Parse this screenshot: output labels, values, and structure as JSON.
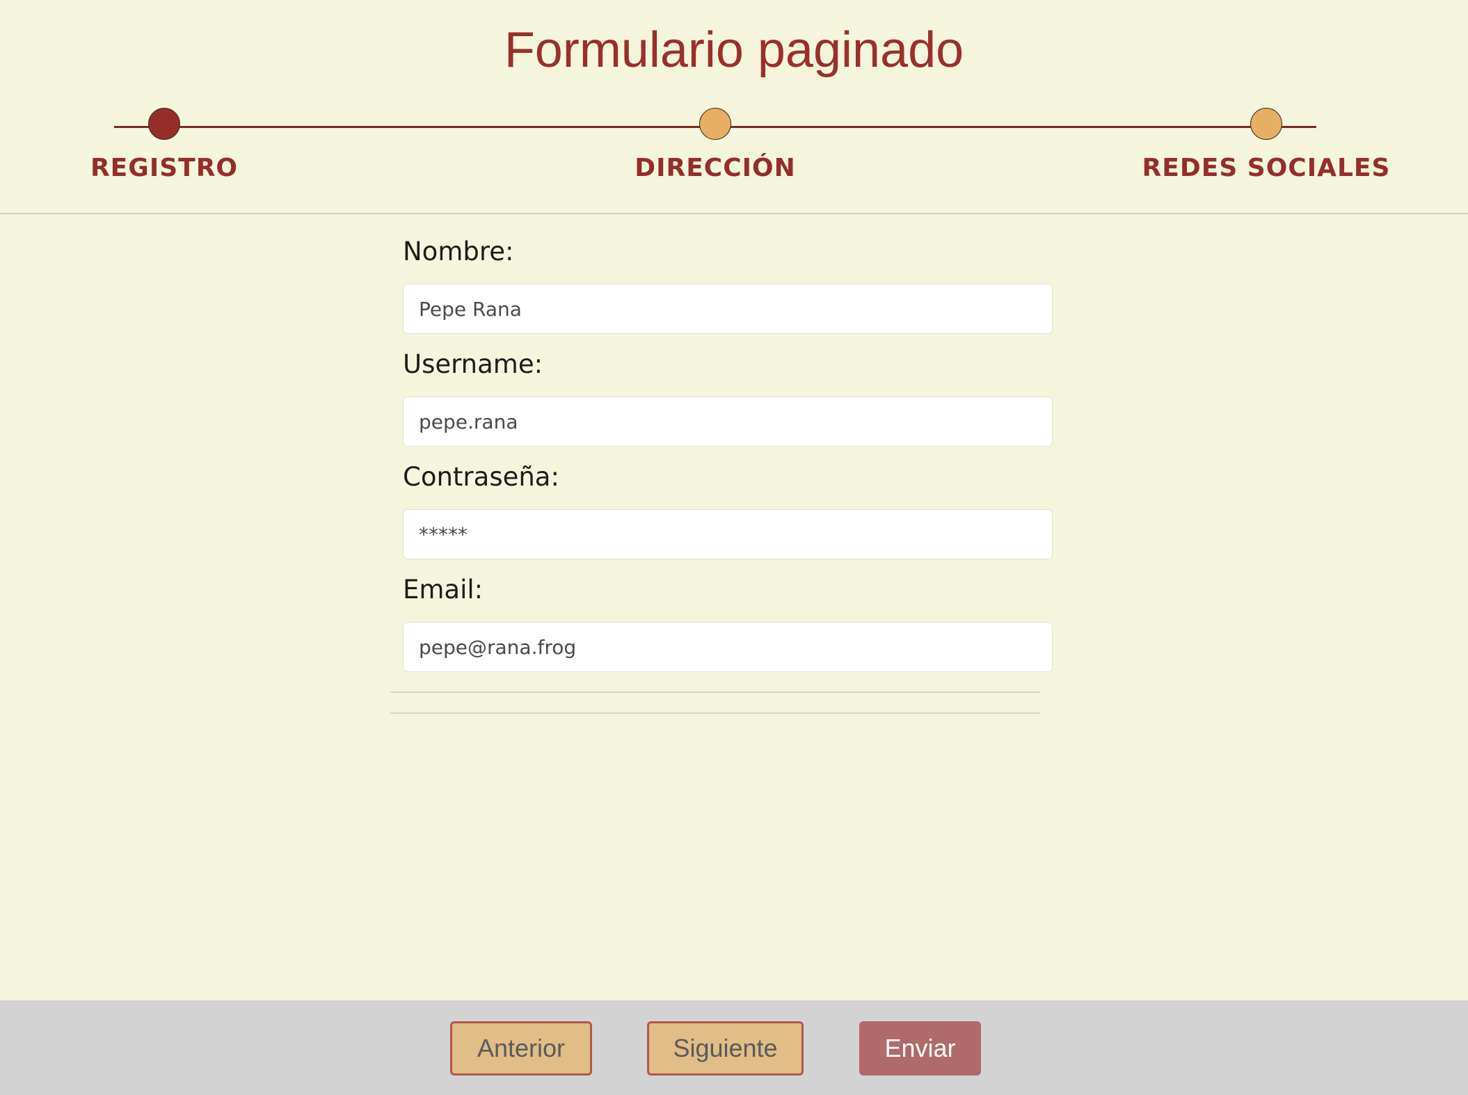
{
  "header": {
    "title": "Formulario paginado"
  },
  "stepper": {
    "steps": [
      {
        "label": "REGISTRO",
        "state": "active"
      },
      {
        "label": "DIRECCIÓN",
        "state": "pending"
      },
      {
        "label": "REDES SOCIALES",
        "state": "pending"
      }
    ]
  },
  "form": {
    "nombre": {
      "label": "Nombre:",
      "value": "Pepe Rana"
    },
    "username": {
      "label": "Username:",
      "value": "pepe.rana"
    },
    "password": {
      "label": "Contraseña:",
      "value": "*****"
    },
    "email": {
      "label": "Email:",
      "value": "pepe@rana.frog"
    }
  },
  "footer": {
    "prev_label": "Anterior",
    "next_label": "Siguiente",
    "submit_label": "Enviar"
  },
  "colors": {
    "background": "#f5f4dd",
    "accent": "#952d2b",
    "step_pending": "#e6b064",
    "button_secondary": "#e1bd87",
    "button_primary": "#b06a6a",
    "footer_bg": "#d3d3d3"
  }
}
